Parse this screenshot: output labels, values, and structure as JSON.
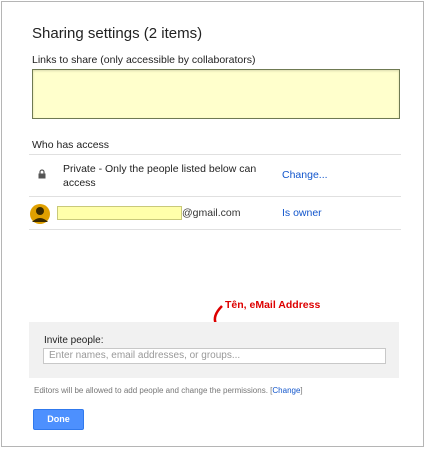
{
  "dialog": {
    "title": "Sharing settings (2 items)",
    "links_label": "Links to share (only accessible by collaborators)",
    "links_value": "",
    "who_has_access_label": "Who has access"
  },
  "access_rows": [
    {
      "icon": "lock-icon",
      "text": "Private - Only the people listed below can access",
      "action": "Change..."
    },
    {
      "icon": "user-avatar",
      "name": "",
      "email_suffix": "@gmail.com",
      "role": "Is owner"
    }
  ],
  "annotation": {
    "text": "Tên, eMail Address",
    "color": "#dd0000"
  },
  "invite": {
    "label": "Invite people:",
    "placeholder": "Enter names, email addresses, or groups..."
  },
  "editors_note": {
    "text": "Editors will be allowed to add people and change the permissions.",
    "open_bracket": "[",
    "link": "Change",
    "close_bracket": "]"
  },
  "done_button": "Done",
  "colors": {
    "link": "#1155cc",
    "primary_button": "#4d90fe",
    "highlight": "#ffffcc",
    "annotation": "#dd0000"
  }
}
